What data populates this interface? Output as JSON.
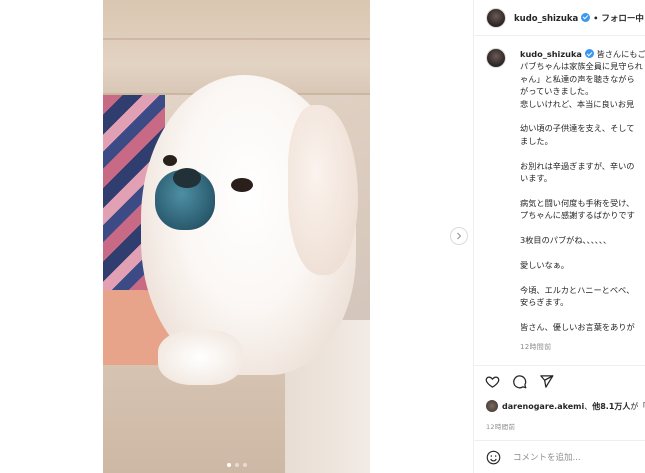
{
  "post": {
    "username": "kudo_shizuka",
    "follow_status": "フォロー中",
    "separator": "•",
    "carousel": {
      "total": 3,
      "current": 1
    },
    "caption": {
      "username": "kudo_shizuka",
      "lines": [
        "皆さんにもご報",
        "パブちゃんは家族全員に見守られ",
        "ゃん」と私達の声を聴きながら",
        "がっていきました。",
        "悲しいけれど、本当に良いお見"
      ],
      "paragraphs": [
        [
          "幼い頃の子供達を支え、そして",
          "ました。"
        ],
        [
          "お別れは辛過ぎますが、辛いの",
          "います。"
        ],
        [
          "病気と闘い何度も手術を受け、",
          "プちゃんに感謝するばかりです"
        ],
        [
          "3枚目のパブがね、、、、、、"
        ],
        [
          "愛しいなぁ。"
        ],
        [
          "今頃、エルカとハニーとベベ、",
          "安らぎます。"
        ],
        [
          "皆さん、優しいお言葉をありが"
        ]
      ],
      "time": "12時間前"
    },
    "likes": {
      "user": "darenogare.akemi",
      "joiner": "、",
      "others": "他8.1万人",
      "suffix": "が「"
    },
    "time": "12時間前",
    "comment_placeholder": "コメントを追加..."
  },
  "icons": {
    "heart": "heart-icon",
    "comment": "comment-icon",
    "share": "share-icon",
    "emoji": "emoji-icon",
    "next": "chevron-right-icon",
    "verified": "verified-badge-icon"
  },
  "colors": {
    "verified": "#3897f0",
    "text": "#262626",
    "muted": "#8e8e8e",
    "border": "#efefef"
  }
}
